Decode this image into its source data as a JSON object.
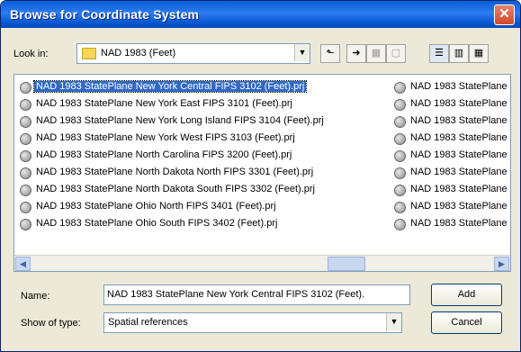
{
  "window": {
    "title": "Browse for Coordinate System",
    "close_icon": "close-icon"
  },
  "toolbar": {
    "lookin_label": "Look in:",
    "lookin_value": "NAD 1983 (Feet)",
    "buttons": [
      "up-folder-icon",
      "connect-folder-icon",
      "disconnect-folder-icon",
      "new-folder-icon",
      "list-view-icon",
      "details-view-icon",
      "thumbnails-view-icon"
    ]
  },
  "files": {
    "column1": [
      "NAD 1983 StatePlane New York Central FIPS 3102 (Feet).prj",
      "NAD 1983 StatePlane New York East FIPS 3101 (Feet).prj",
      "NAD 1983 StatePlane New York Long Island FIPS 3104 (Feet).prj",
      "NAD 1983 StatePlane New York West FIPS 3103 (Feet).prj",
      "NAD 1983 StatePlane North Carolina FIPS 3200 (Feet).prj",
      "NAD 1983 StatePlane North Dakota North FIPS 3301 (Feet).prj",
      "NAD 1983 StatePlane North Dakota South FIPS 3302 (Feet).prj",
      "NAD 1983 StatePlane Ohio North FIPS 3401 (Feet).prj",
      "NAD 1983 StatePlane Ohio South FIPS 3402 (Feet).prj"
    ],
    "column2": [
      "NAD 1983 StatePlane",
      "NAD 1983 StatePlane",
      "NAD 1983 StatePlane",
      "NAD 1983 StatePlane",
      "NAD 1983 StatePlane",
      "NAD 1983 StatePlane",
      "NAD 1983 StatePlane",
      "NAD 1983 StatePlane",
      "NAD 1983 StatePlane"
    ],
    "selected_index": 0
  },
  "form": {
    "name_label": "Name:",
    "name_value": "NAD 1983 StatePlane New York Central FIPS 3102 (Feet).",
    "type_label": "Show of type:",
    "type_value": "Spatial references"
  },
  "buttons": {
    "add": "Add",
    "cancel": "Cancel"
  }
}
